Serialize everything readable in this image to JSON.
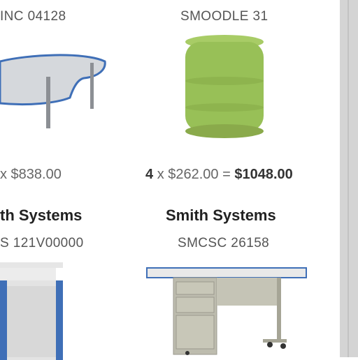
{
  "products": [
    {
      "code": "INC 04128",
      "qty": "",
      "unit_price": "x $838.00",
      "total": "",
      "brand": ""
    },
    {
      "code": "SMOODLE 31",
      "qty": "4",
      "unit_price": "x $262.00 =",
      "total": "$1048.00",
      "brand": ""
    },
    {
      "brand": "th Systems",
      "code": "S 121V00000"
    },
    {
      "brand": "Smith Systems",
      "code": "SMCSC 26158"
    }
  ],
  "colors": {
    "table_top": "#c9ccd0",
    "table_edge": "#3f6fb7",
    "stool_green": "#9bc25a",
    "desk_metal": "#b9b7a8",
    "desk_top": "#e8e8e8"
  }
}
